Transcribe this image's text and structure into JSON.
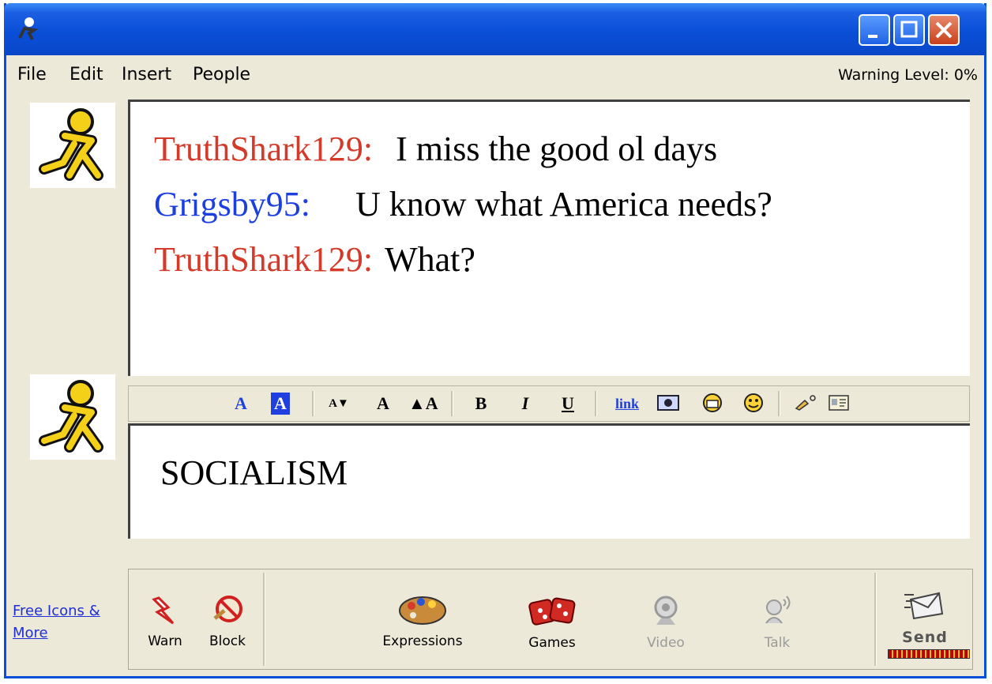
{
  "menu": {
    "items": [
      "File",
      "Edit",
      "Insert",
      "People"
    ],
    "warning_level": "Warning Level: 0%"
  },
  "conversation": {
    "messages": [
      {
        "sender": "TruthShark129:",
        "text": "I miss the good ol days",
        "color": "#d43a2a"
      },
      {
        "sender": "Grigsby95:",
        "text": "U know what America needs?",
        "color": "#1b3fe0"
      },
      {
        "sender": "TruthShark129:",
        "text": "What?",
        "color": "#d43a2a"
      }
    ]
  },
  "toolbar": {
    "tools": [
      "text-color-icon",
      "background-color-icon",
      "decrease-font-icon",
      "normal-font-icon",
      "increase-font-icon",
      "bold-icon",
      "italic-icon",
      "underline-icon",
      "link-icon",
      "insert-picture-icon",
      "email-icon",
      "smiley-icon",
      "signature-icon",
      "buddy-info-icon"
    ],
    "link_label": "link"
  },
  "compose": {
    "text": "SOCIALISM"
  },
  "sidebar": {
    "free_icons_link": "Free Icons & More"
  },
  "bottom_bar": {
    "warn": "Warn",
    "block": "Block",
    "expressions": "Expressions",
    "games": "Games",
    "video": "Video",
    "talk": "Talk",
    "send": "Send"
  }
}
